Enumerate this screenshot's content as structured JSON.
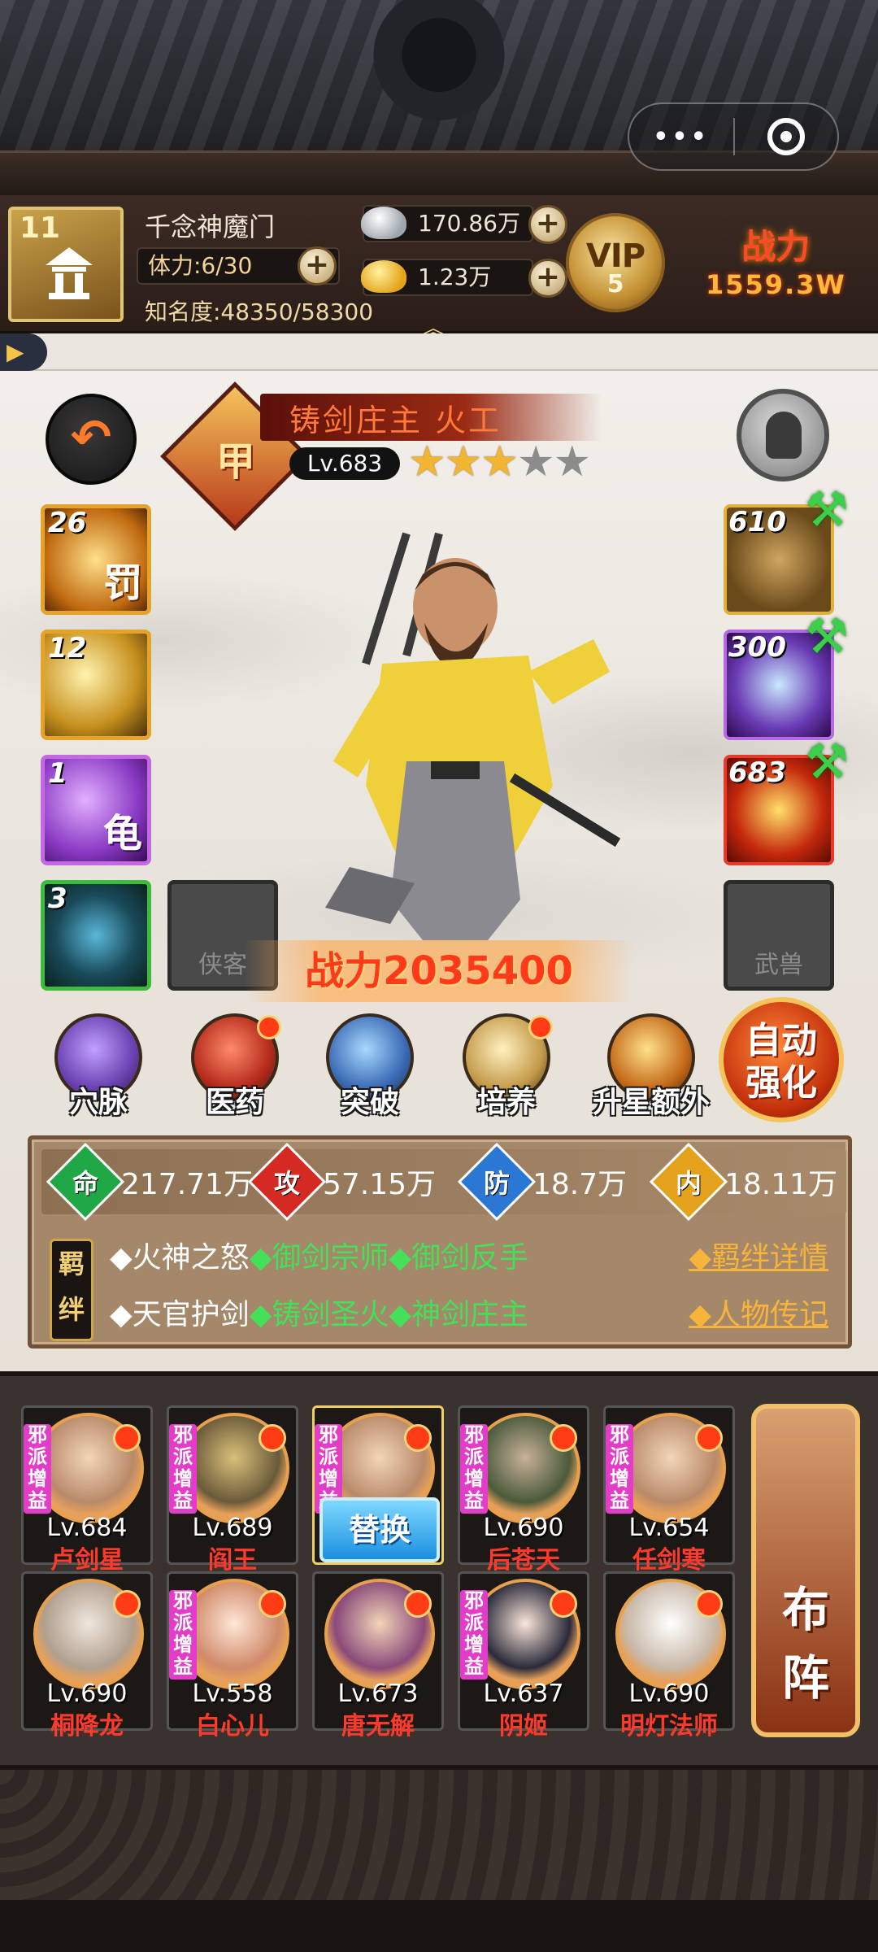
{
  "capsule": {
    "more_icon": "ellipsis-icon",
    "close_icon": "target-close-icon"
  },
  "header": {
    "player_level": "11",
    "player_name": "千念神魔门",
    "stamina": "体力:6/30",
    "fame": "知名度:48350/58300",
    "silver": "170.86万",
    "gold": "1.23万",
    "vip_label": "VIP",
    "vip_level": "5",
    "power_label": "战力",
    "power_value": "1559.3W"
  },
  "hero": {
    "grade": "甲",
    "name": "铸剑庄主 火工",
    "level": "Lv.683",
    "stars_filled": 3,
    "stars_total": 5,
    "battle_power": "战力2035400"
  },
  "skills": [
    {
      "count": "26",
      "glyph": "罚"
    },
    {
      "count": "12",
      "glyph": ""
    },
    {
      "count": "1",
      "glyph": "龟"
    },
    {
      "count": "3",
      "glyph": ""
    }
  ],
  "empty_slots": {
    "companion": "侠客",
    "martial": "武兽"
  },
  "equipment": [
    {
      "count": "610",
      "item": "dart-icon"
    },
    {
      "count": "300",
      "item": "bracer-icon"
    },
    {
      "count": "683",
      "item": "golden-armor-icon"
    }
  ],
  "functions": [
    {
      "label": "穴脉",
      "dot": false
    },
    {
      "label": "医药",
      "dot": true
    },
    {
      "label": "突破",
      "dot": false
    },
    {
      "label": "培养",
      "dot": true
    },
    {
      "label": "升星额外",
      "dot": false
    }
  ],
  "auto_enhance": "自动强化",
  "stats": [
    {
      "key": "命",
      "value": "217.71万",
      "color": "#1fa845"
    },
    {
      "key": "攻",
      "value": "57.15万",
      "color": "#d42a22"
    },
    {
      "key": "防",
      "value": "18.7万",
      "color": "#2a78d4"
    },
    {
      "key": "内",
      "value": "18.11万",
      "color": "#e3a11c"
    }
  ],
  "bonds": {
    "label": "羁绊",
    "line1": [
      "◆火神之怒",
      "◆御剑宗师",
      "◆御剑反手"
    ],
    "line2": [
      "◆天官护剑",
      "◆铸剑圣火",
      "◆神剑庄主"
    ],
    "detail_link": "◆羁绊详情",
    "bio_link": "◆人物传记"
  },
  "roster": [
    {
      "level": "Lv.684",
      "name": "卢剑星",
      "tag": "邪派增益"
    },
    {
      "level": "Lv.689",
      "name": "阎王",
      "tag": "邪派增益"
    },
    {
      "level": "",
      "name": "",
      "tag": "邪派增益",
      "swap": "替换"
    },
    {
      "level": "Lv.690",
      "name": "后苍天",
      "tag": "邪派增益"
    },
    {
      "level": "Lv.654",
      "name": "任剑寒",
      "tag": "邪派增益"
    },
    {
      "level": "Lv.690",
      "name": "桐降龙",
      "tag": ""
    },
    {
      "level": "Lv.558",
      "name": "白心儿",
      "tag": "邪派增益"
    },
    {
      "level": "Lv.673",
      "name": "唐无解",
      "tag": ""
    },
    {
      "level": "Lv.637",
      "name": "阴姬",
      "tag": "邪派增益"
    },
    {
      "level": "Lv.690",
      "name": "明灯法师",
      "tag": ""
    }
  ],
  "formation": "布阵"
}
